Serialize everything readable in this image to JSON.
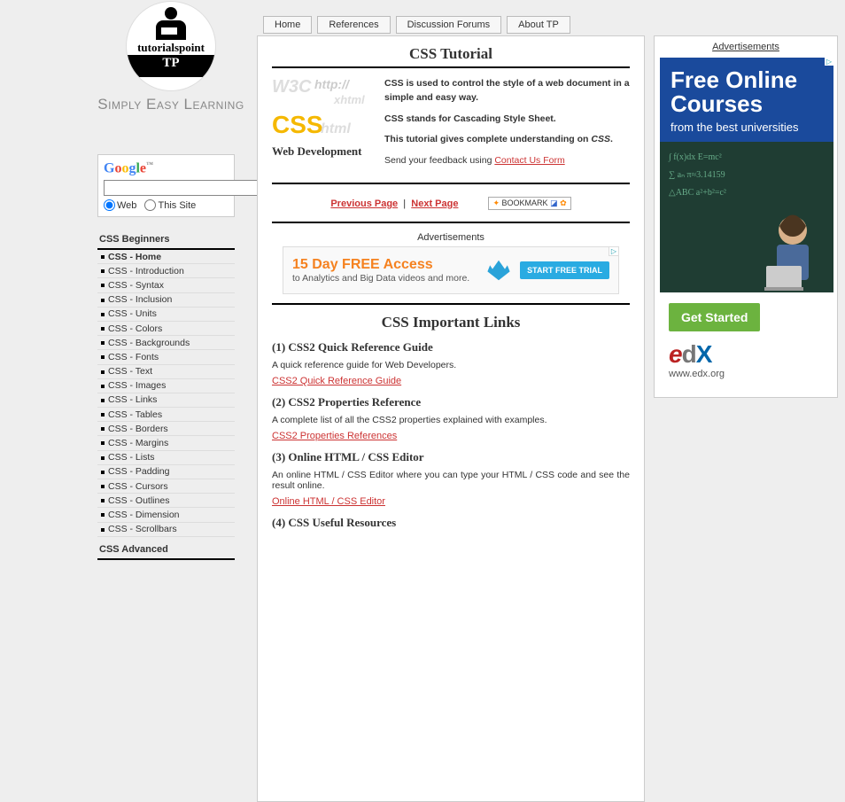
{
  "logo": {
    "brand": "tutorialspoint",
    "tp": "TP",
    "tagline": "Simply Easy Learning"
  },
  "search": {
    "engine_parts": [
      "G",
      "o",
      "o",
      "g",
      "l",
      "e"
    ],
    "button": "...",
    "radio_web": "Web",
    "radio_site": "This Site"
  },
  "sidebar": {
    "head1": "CSS Beginners",
    "items1": [
      "CSS - Home",
      "CSS - Introduction",
      "CSS - Syntax",
      "CSS - Inclusion",
      "CSS - Units",
      "CSS - Colors",
      "CSS - Backgrounds",
      "CSS - Fonts",
      "CSS - Text",
      "CSS - Images",
      "CSS - Links",
      "CSS - Tables",
      "CSS - Borders",
      "CSS - Margins",
      "CSS - Lists",
      "CSS - Padding",
      "CSS - Cursors",
      "CSS - Outlines",
      "CSS - Dimension",
      "CSS - Scrollbars"
    ],
    "head2": "CSS Advanced"
  },
  "topnav": [
    "Home",
    "References",
    "Discussion Forums",
    "About TP"
  ],
  "main": {
    "title": "CSS Tutorial",
    "graphic_words": {
      "w3c": "W3C",
      "http": "http://",
      "xhtml": "xhtml",
      "css": "CSS",
      "html": "html",
      "web": "Web Development"
    },
    "p1a": "CSS is used to control the style of a web document in a simple and easy way.",
    "p2a": "CSS stands for Cascading Style Sheet.",
    "p3a": "This tutorial gives complete understanding on ",
    "p3b": "CSS",
    "p3c": ".",
    "p4a": "Send your feedback using ",
    "p4link": "Contact Us Form",
    "prev": "Previous Page",
    "next": "Next Page",
    "bookmark": "BOOKMARK",
    "ad_label": "Advertisements",
    "inline_ad": {
      "l1": "15 Day FREE Access",
      "l2": "to Analytics and Big Data videos and more.",
      "cta": "START FREE TRIAL"
    },
    "h2": "CSS Important Links",
    "sec1": {
      "h": "(1) CSS2 Quick Reference Guide",
      "p": "A quick reference guide for Web Developers.",
      "a": "CSS2 Quick Reference Guide"
    },
    "sec2": {
      "h": "(2) CSS2 Properties Reference",
      "p": "A complete list of all the CSS2 properties explained with examples.",
      "a": "CSS2 Properties References"
    },
    "sec3": {
      "h": "(3) Online HTML / CSS Editor",
      "p": "An online HTML / CSS Editor where you can type your HTML / CSS code and see the result online.",
      "a": "Online HTML / CSS Editor"
    },
    "sec4": {
      "h": "(4) CSS Useful Resources"
    }
  },
  "right_ad": {
    "label": "Advertisements",
    "l1": "Free Online Courses",
    "l2": "from the best universities",
    "cta": "Get Started",
    "url": "www.edx.org"
  }
}
